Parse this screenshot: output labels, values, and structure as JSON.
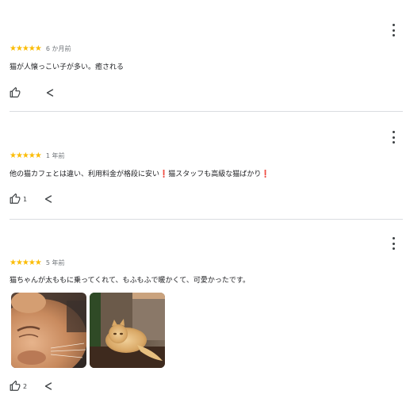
{
  "reviews": [
    {
      "rating_text": "★★★★★",
      "rating": 5,
      "time_ago": "6 か月前",
      "text": "猫が人懐っこい子が多い。癒される",
      "like_count": "",
      "icons": [
        "more-vert-icon",
        "thumb-up-icon",
        "share-icon"
      ]
    },
    {
      "rating_text": "★★★★★",
      "rating": 5,
      "time_ago": "1 年前",
      "text_parts": [
        "他の猫カフェとは違い、利用料金が格段に安い",
        "❗",
        "猫スタッフも高級な猫ばかり",
        "❗"
      ],
      "like_count": "1",
      "icons": [
        "more-vert-icon",
        "thumb-up-icon",
        "share-icon"
      ]
    },
    {
      "rating_text": "★★★★★",
      "rating": 5,
      "time_ago": "5 年前",
      "text": "猫ちゃんが太ももに乗ってくれて、もふもふで暖かくて、可愛かったです。",
      "photos": [
        "cat-closeup-photo",
        "cat-on-ledge-photo"
      ],
      "like_count": "2",
      "icons": [
        "more-vert-icon",
        "thumb-up-icon",
        "share-icon"
      ]
    }
  ],
  "colors": {
    "star": "#fbbc04",
    "exclamation": "#ea4335",
    "divider": "#dadce0",
    "meta_text": "#70757a"
  }
}
